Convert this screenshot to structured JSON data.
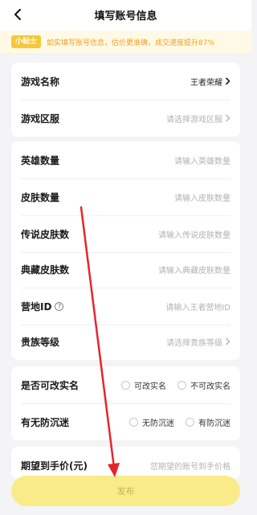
{
  "header": {
    "title": "填写账号信息"
  },
  "tip": {
    "badge": "小帖士",
    "text": "如实填写账号信息，估价更准确，成交速度提升87%"
  },
  "card1": {
    "game_name": {
      "label": "游戏名称",
      "value": "王者荣耀"
    },
    "game_server": {
      "label": "游戏区服",
      "placeholder": "请选择游戏区服"
    }
  },
  "card2": {
    "heroes": {
      "label": "英雄数量",
      "placeholder": "请输入英雄数量"
    },
    "skins": {
      "label": "皮肤数量",
      "placeholder": "请输入皮肤数量"
    },
    "legend_skins": {
      "label": "传说皮肤数",
      "placeholder": "请输入传说皮肤数量"
    },
    "collection_skins": {
      "label": "典藏皮肤数",
      "placeholder": "请输入典藏皮肤数量"
    },
    "camp_id": {
      "label": "营地ID",
      "placeholder": "请输入王者营地ID"
    },
    "noble_level": {
      "label": "贵族等级",
      "placeholder": "请选择贵族等级"
    }
  },
  "card3": {
    "realname": {
      "label": "是否可改实名",
      "option_yes": "可改实名",
      "option_no": "不可改实名"
    },
    "anti_addiction": {
      "label": "有无防沉迷",
      "option_no": "无防沉迷",
      "option_yes": "有防沉迷"
    }
  },
  "card4": {
    "price": {
      "label": "期望到手价(元)",
      "placeholder": "您期望的账号到手价格"
    }
  },
  "footer": {
    "publish_label": "发布"
  },
  "colors": {
    "accent": "#f7c63b",
    "button": "#faeb8a",
    "annotation": "#e3262b"
  }
}
